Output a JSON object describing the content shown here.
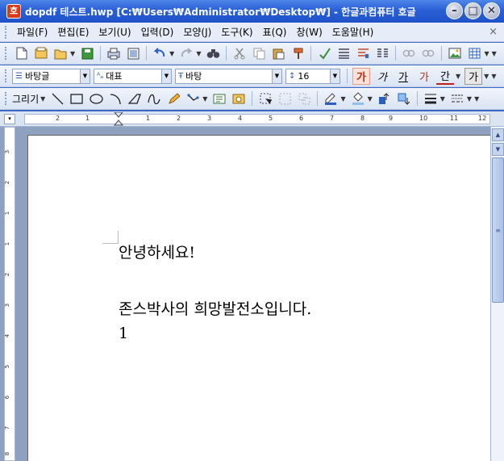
{
  "window": {
    "title": "dopdf 테스트.hwp [C:₩Users₩Administrator₩Desktop₩] - 한글과컴퓨터 호글",
    "app_icon": "호",
    "minimize_symbol": "–",
    "restore_symbol": "□",
    "close_symbol": "✕"
  },
  "menu": {
    "items": [
      "파일(F)",
      "편집(E)",
      "보기(U)",
      "입력(D)",
      "모양(J)",
      "도구(K)",
      "표(Q)",
      "창(W)",
      "도움말(H)"
    ],
    "close_symbol": "×"
  },
  "toolbar2": {
    "style_combo": "바탕글",
    "face_combo": "대표",
    "font_combo": "바탕",
    "size_combo": "16",
    "format_buttons": [
      "가",
      "가",
      "가",
      "가",
      "간",
      "가"
    ]
  },
  "toolbar3": {
    "draw_label": "그리기"
  },
  "ruler": {
    "corner": "▾",
    "ticks": [
      "2",
      "1",
      "1",
      "2",
      "3",
      "4",
      "5",
      "6",
      "7",
      "8",
      "9",
      "10",
      "11",
      "12"
    ]
  },
  "vruler": {
    "ticks": [
      "3",
      "2",
      "1",
      "1",
      "2",
      "3",
      "4",
      "5",
      "6",
      "7",
      "8"
    ]
  },
  "document": {
    "lines": [
      "안녕하세요!",
      "존스박사의 희망발전소입니다.",
      "1"
    ]
  },
  "scrollbar": {
    "up": "▲",
    "down": "▼",
    "thumb_grip": "≡"
  }
}
